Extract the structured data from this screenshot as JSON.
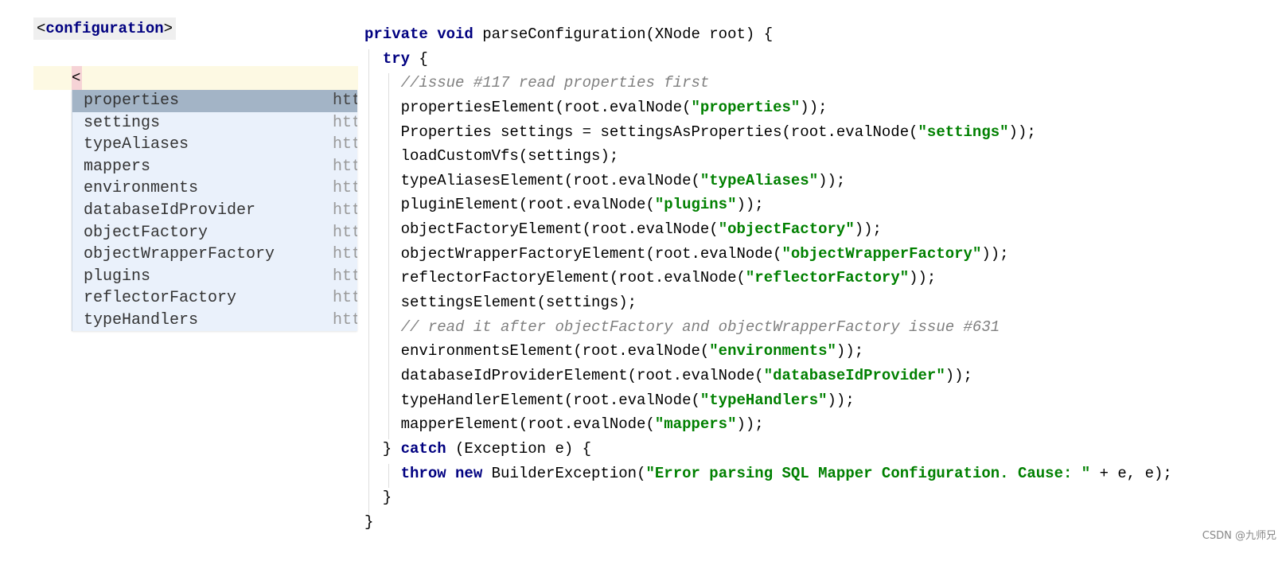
{
  "xml": {
    "open_tag_prefix": "<",
    "open_tag_name": "configuration",
    "open_tag_suffix": ">",
    "caret_text": "<"
  },
  "completion_popup": {
    "items": [
      {
        "name": "properties",
        "ns": "htt",
        "selected": true
      },
      {
        "name": "settings",
        "ns": "htt"
      },
      {
        "name": "typeAliases",
        "ns": "htt"
      },
      {
        "name": "mappers",
        "ns": "htt"
      },
      {
        "name": "environments",
        "ns": "htt"
      },
      {
        "name": "databaseIdProvider",
        "ns": "htt"
      },
      {
        "name": "objectFactory",
        "ns": "htt"
      },
      {
        "name": "objectWrapperFactory",
        "ns": "htt"
      },
      {
        "name": "plugins",
        "ns": "htt"
      },
      {
        "name": "reflectorFactory",
        "ns": "htt"
      },
      {
        "name": "typeHandlers",
        "ns": "htt"
      }
    ]
  },
  "code": {
    "lines": [
      [
        [
          "k",
          "private void "
        ],
        [
          "p",
          "parseConfiguration(XNode root) {"
        ]
      ],
      [
        [
          "p",
          "  "
        ],
        [
          "k",
          "try"
        ],
        [
          "p",
          " {"
        ]
      ],
      [
        [
          "p",
          "    "
        ],
        [
          "c",
          "//issue #117 read properties first"
        ]
      ],
      [
        [
          "p",
          "    propertiesElement(root.evalNode("
        ],
        [
          "s",
          "\"properties\""
        ],
        [
          "p",
          "));"
        ]
      ],
      [
        [
          "p",
          "    Properties settings = settingsAsProperties(root.evalNode("
        ],
        [
          "s",
          "\"settings\""
        ],
        [
          "p",
          "));"
        ]
      ],
      [
        [
          "p",
          "    loadCustomVfs(settings);"
        ]
      ],
      [
        [
          "p",
          "    typeAliasesElement(root.evalNode("
        ],
        [
          "s",
          "\"typeAliases\""
        ],
        [
          "p",
          "));"
        ]
      ],
      [
        [
          "p",
          "    pluginElement(root.evalNode("
        ],
        [
          "s",
          "\"plugins\""
        ],
        [
          "p",
          "));"
        ]
      ],
      [
        [
          "p",
          "    objectFactoryElement(root.evalNode("
        ],
        [
          "s",
          "\"objectFactory\""
        ],
        [
          "p",
          "));"
        ]
      ],
      [
        [
          "p",
          "    objectWrapperFactoryElement(root.evalNode("
        ],
        [
          "s",
          "\"objectWrapperFactory\""
        ],
        [
          "p",
          "));"
        ]
      ],
      [
        [
          "p",
          "    reflectorFactoryElement(root.evalNode("
        ],
        [
          "s",
          "\"reflectorFactory\""
        ],
        [
          "p",
          "));"
        ]
      ],
      [
        [
          "p",
          "    settingsElement(settings);"
        ]
      ],
      [
        [
          "p",
          "    "
        ],
        [
          "c",
          "// read it after objectFactory and objectWrapperFactory issue #631"
        ]
      ],
      [
        [
          "p",
          "    environmentsElement(root.evalNode("
        ],
        [
          "s",
          "\"environments\""
        ],
        [
          "p",
          "));"
        ]
      ],
      [
        [
          "p",
          "    databaseIdProviderElement(root.evalNode("
        ],
        [
          "s",
          "\"databaseIdProvider\""
        ],
        [
          "p",
          "));"
        ]
      ],
      [
        [
          "p",
          "    typeHandlerElement(root.evalNode("
        ],
        [
          "s",
          "\"typeHandlers\""
        ],
        [
          "p",
          "));"
        ]
      ],
      [
        [
          "p",
          "    mapperElement(root.evalNode("
        ],
        [
          "s",
          "\"mappers\""
        ],
        [
          "p",
          "));"
        ]
      ],
      [
        [
          "p",
          "  } "
        ],
        [
          "k",
          "catch"
        ],
        [
          "p",
          " (Exception e) {"
        ]
      ],
      [
        [
          "p",
          "    "
        ],
        [
          "k",
          "throw new "
        ],
        [
          "p",
          "BuilderException("
        ],
        [
          "s",
          "\"Error parsing SQL Mapper Configuration. Cause: \""
        ],
        [
          "p",
          " + e, e);"
        ]
      ],
      [
        [
          "p",
          "  }"
        ]
      ],
      [
        [
          "p",
          "}"
        ]
      ]
    ]
  },
  "watermark": "CSDN @九师兄",
  "colors": {
    "keyword": "#000080",
    "string": "#008000",
    "comment": "#808080",
    "selection": "#a3b4c6",
    "popup_bg": "#eaf1fb",
    "current_line": "#fdf9e3"
  }
}
